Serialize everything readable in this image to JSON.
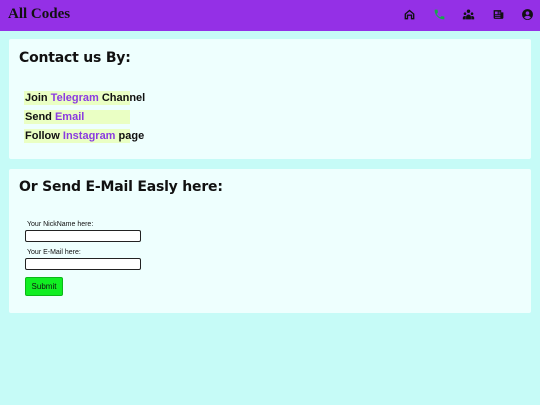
{
  "header": {
    "title": "All Codes",
    "icons": [
      "home-icon",
      "phone-icon",
      "people-icon",
      "newspaper-icon",
      "account-icon"
    ]
  },
  "contact_card": {
    "title": "Contact us By:",
    "lines": [
      {
        "prefix": "Join ",
        "link": "Telegram",
        "suffix": " Channel"
      },
      {
        "prefix": "Send ",
        "link": "Email",
        "suffix": ""
      },
      {
        "prefix": "Follow ",
        "link": "Instagram",
        "suffix": " page"
      }
    ]
  },
  "email_card": {
    "title": "Or Send E-Mail Easly here:",
    "nickname_label": "Your NickName here:",
    "nickname_value": "",
    "email_label": "Your E-Mail here:",
    "email_value": "",
    "submit_label": "Submit"
  },
  "colors": {
    "header_bg": "#9430e6",
    "page_bg": "#c6fbf7",
    "card_bg": "#eefffe",
    "link": "#8a3be0",
    "highlight": "#eaffc4",
    "submit_bg": "#11ee22"
  }
}
